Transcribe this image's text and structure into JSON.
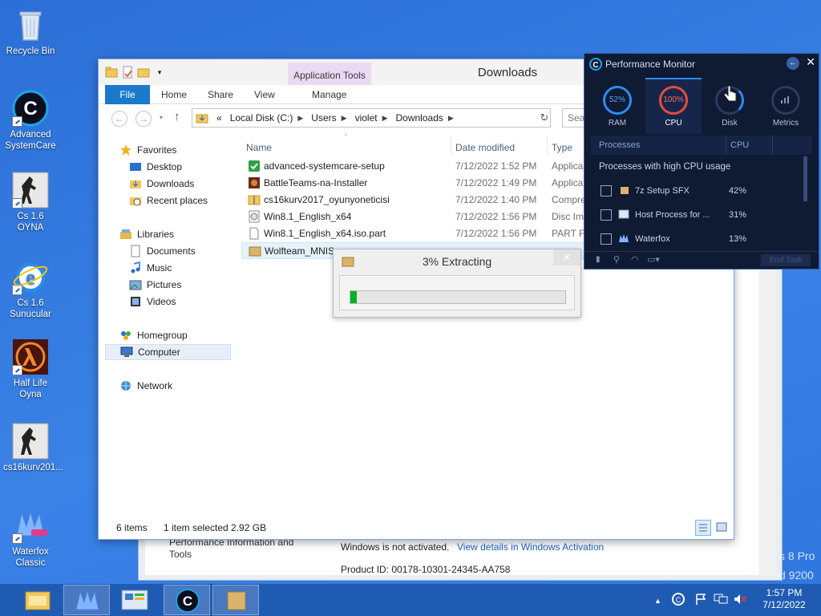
{
  "desktop": {
    "icons": [
      {
        "label": "Recycle Bin"
      },
      {
        "label": "Advanced SystemCare"
      },
      {
        "label": "Cs 1.6 OYNA"
      },
      {
        "label": "Cs 1.6 Sunucular"
      },
      {
        "label": "Half Life Oyna"
      },
      {
        "label": "cs16kurv201..."
      },
      {
        "label": "Waterfox Classic"
      }
    ],
    "watermark_line1": "s 8 Pro",
    "watermark_line2": "d 9200"
  },
  "background_window": {
    "perf_link": "Performance Information and Tools",
    "activation_text": "Windows is not activated.",
    "activation_link": "View details in Windows Activation",
    "product_id": "Product ID:  00178-10301-24345-AA758"
  },
  "explorer": {
    "title": "Downloads",
    "context_tab_group": "Application Tools",
    "ribbon_tabs": [
      "File",
      "Home",
      "Share",
      "View",
      "Manage"
    ],
    "breadcrumb": [
      "Local Disk (C:)",
      "Users",
      "violet",
      "Downloads"
    ],
    "breadcrumb_prefix": "«",
    "search_placeholder": "Sea",
    "nav": {
      "favorites": "Favorites",
      "desktop": "Desktop",
      "downloads": "Downloads",
      "recent": "Recent places",
      "libraries": "Libraries",
      "documents": "Documents",
      "music": "Music",
      "pictures": "Pictures",
      "videos": "Videos",
      "homegroup": "Homegroup",
      "computer": "Computer",
      "network": "Network"
    },
    "columns": {
      "name": "Name",
      "date": "Date modified",
      "type": "Type"
    },
    "files": [
      {
        "name": "advanced-systemcare-setup",
        "date": "7/12/2022 1:52 PM",
        "type": "Applica"
      },
      {
        "name": "BattleTeams-na-Installer",
        "date": "7/12/2022 1:49 PM",
        "type": "Applica"
      },
      {
        "name": "cs16kurv2017_oyunyoneticisi",
        "date": "7/12/2022 1:40 PM",
        "type": "Compre"
      },
      {
        "name": "Win8.1_English_x64",
        "date": "7/12/2022 1:56 PM",
        "type": "Disc Im"
      },
      {
        "name": "Win8.1_English_x64.iso.part",
        "date": "7/12/2022 1:56 PM",
        "type": "PART F"
      },
      {
        "name": "Wolfteam_MNIS",
        "date": "",
        "type": ""
      }
    ],
    "status_items": "6 items",
    "status_selected": "1 item selected  2.92 GB"
  },
  "extract_dialog": {
    "title": "3% Extracting",
    "progress_percent": 3
  },
  "perf_monitor": {
    "title": "Performance Monitor",
    "gauges": [
      {
        "label": "RAM",
        "value": "52%",
        "color": "#2d8cf0"
      },
      {
        "label": "CPU",
        "value": "100%",
        "color": "#e74c3c"
      },
      {
        "label": "Disk",
        "value": "",
        "color": "#2d8cf0"
      },
      {
        "label": "Metrics",
        "value": "",
        "color": "#8a96b2"
      }
    ],
    "header_processes": "Processes",
    "header_cpu": "CPU",
    "section_title": "Processes with high CPU usage",
    "processes": [
      {
        "name": "7z Setup SFX",
        "cpu": "42%"
      },
      {
        "name": "Host Process for ...",
        "cpu": "31%"
      },
      {
        "name": "Waterfox",
        "cpu": "13%"
      }
    ],
    "end_task": "End Task"
  },
  "taskbar": {
    "time": "1:57 PM",
    "date": "7/12/2022"
  },
  "colors": {
    "desktop": "#2f77e0",
    "taskbar": "#1f5bb3",
    "file_tab": "#1979ca",
    "progress": "#06b025",
    "perf_bg": "#0f1a33"
  }
}
